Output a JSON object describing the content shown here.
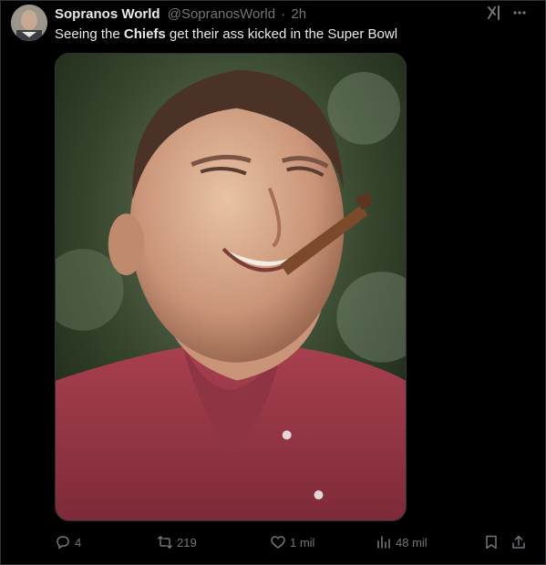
{
  "tweet": {
    "author_name": "Sopranos World",
    "author_handle": "@SopranosWorld",
    "separator": "·",
    "time": "2h",
    "text_parts": {
      "before": "Seeing the ",
      "bold": "Chiefs",
      "after": " get their ass kicked in the Super Bowl"
    }
  },
  "actions": {
    "replies": "4",
    "reposts": "219",
    "likes": "1 mil",
    "views": "48 mil"
  },
  "icons": {
    "avatar": "profile-photo",
    "grok": "grok-icon",
    "more": "more-icon",
    "reply": "reply-icon",
    "repost": "repost-icon",
    "like": "heart-icon",
    "views": "views-icon",
    "bookmark": "bookmark-icon",
    "share": "share-icon"
  },
  "colors": {
    "background": "#000000",
    "text": "#e7e9ea",
    "muted": "#71767b",
    "border": "#2f3336"
  }
}
